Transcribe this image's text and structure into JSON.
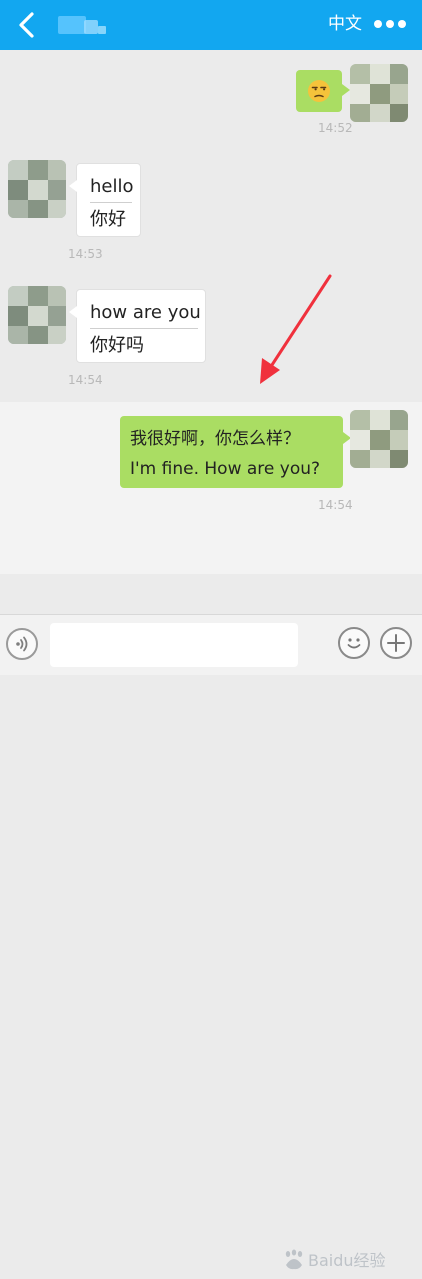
{
  "header": {
    "back_icon": "chevron-left-icon",
    "language_button": "中文",
    "more_icon": "more-dots-icon",
    "background_color": "#12a7f0"
  },
  "messages": [
    {
      "sender": "self",
      "content_icon": "unamused-face-emoji",
      "time": "14:52"
    },
    {
      "sender": "other",
      "original": "hello",
      "translation": "你好",
      "time": "14:53"
    },
    {
      "sender": "other",
      "original": "how are you",
      "translation": "你好吗",
      "time": "14:54"
    },
    {
      "sender": "self",
      "original": "我很好啊，你怎么样？",
      "translation": "I'm fine. How are you?",
      "time": "14:54"
    }
  ],
  "input_bar": {
    "voice_icon": "voice-icon",
    "text_value": "",
    "emoji_icon": "emoji-icon",
    "add_icon": "plus-icon"
  },
  "annotation": {
    "arrow_color": "#f0313d"
  },
  "watermark": {
    "text": "Baidu经验"
  },
  "colors": {
    "sent_bubble": "#aadd63",
    "received_bubble": "#ffffff",
    "background": "#ebebeb"
  }
}
